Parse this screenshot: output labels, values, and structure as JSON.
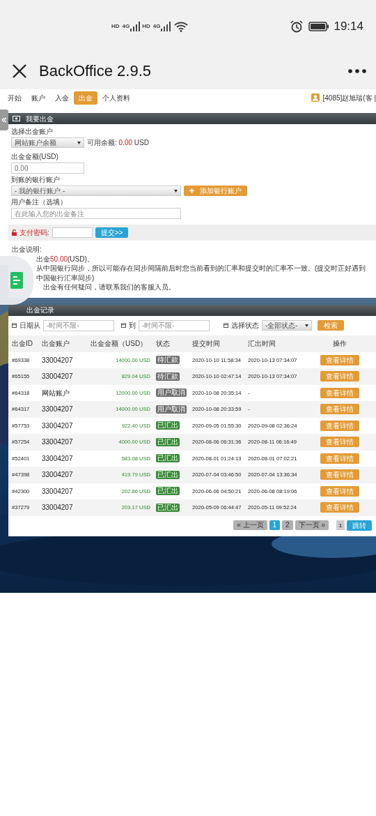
{
  "status_bar": {
    "sims": [
      {
        "hd": "HD",
        "net": "4G"
      },
      {
        "hd": "HD",
        "net": "4G"
      }
    ],
    "time": "19:14"
  },
  "app_bar": {
    "title": "BackOffice 2.9.5"
  },
  "nav": {
    "items": [
      {
        "label": "开始",
        "selected": false
      },
      {
        "label": "账户",
        "selected": false
      },
      {
        "label": "入金",
        "selected": false
      },
      {
        "label": "出金",
        "selected": true
      },
      {
        "label": "个人资料",
        "selected": false
      }
    ],
    "user": "[4085]赵旭瑞(客 |"
  },
  "withdraw_form": {
    "title": "我要出金",
    "account_label": "选择出金账户",
    "account_value": "网站账户余额",
    "balance_label": "可用余额:",
    "balance_value": "0.00",
    "balance_currency": "USD",
    "amount_label": "出金金额(USD)",
    "amount_value": "0.00",
    "bank_label": "到账的银行账户",
    "bank_value": "- 我的银行账户 -",
    "add_bank_button": "添加银行账户",
    "remark_label": "用户备注（选填）",
    "remark_placeholder": "在此输入您的出金备注",
    "password_label": "支付密码:",
    "submit_button": "提交>>"
  },
  "notes": {
    "title": "出金说明:",
    "min_line": {
      "before": "出金",
      "amount": "50.00",
      "after": "(USD)。"
    },
    "lines": [
      "从中国银行同步，所以可能存在同步间隔前后时您当前看到的汇率和提交时的汇率不一致。(提交时正好遇到中国银行汇率同步)",
      "出金有任何疑问，请联系我们的客服人员。"
    ]
  },
  "records": {
    "title": "出金记录",
    "filters": {
      "date_from_label": "日期从",
      "date_from_placeholder": "-时间不限-",
      "date_to_label": "到",
      "date_to_placeholder": "-时间不限-",
      "status_label": "选择状态",
      "status_value": "-全部状态-",
      "search_button": "检索"
    },
    "columns": [
      "出金ID",
      "出金账户",
      "出金金额（USD）",
      "状态",
      "提交时间",
      "汇出时间",
      "操作"
    ],
    "rows": [
      {
        "id": "#69338",
        "account": "33004207",
        "amount": "14000.00 USD",
        "status": "待汇款",
        "kind": "pending",
        "submitted": "2020-10-10 11:58:34",
        "paid": "2020-10-13 07:34:07",
        "action": "查看详情"
      },
      {
        "id": "#65155",
        "account": "33004207",
        "amount": "829.04 USD",
        "status": "待汇款",
        "kind": "pending",
        "submitted": "2020-10-10 02:47:14",
        "paid": "2020-10-13 07:34:07",
        "action": "查看详情"
      },
      {
        "id": "#64318",
        "account": "网站账户",
        "amount": "12000.00 USD",
        "status": "用户取消",
        "kind": "cancelled",
        "submitted": "2020-10-08 20:35:14",
        "paid": "-",
        "action": "查看详情"
      },
      {
        "id": "#64317",
        "account": "33004207",
        "amount": "14000.00 USD",
        "status": "用户取消",
        "kind": "cancelled",
        "submitted": "2020-10-08 20:33:59",
        "paid": "-",
        "action": "查看详情"
      },
      {
        "id": "#57753",
        "account": "33004207",
        "amount": "922.40 USD",
        "status": "已汇出",
        "kind": "paid",
        "submitted": "2020-09-05 01:55:30",
        "paid": "2020-09-08 02:36:24",
        "action": "查看详情"
      },
      {
        "id": "#57254",
        "account": "33004207",
        "amount": "4000.00 USD",
        "status": "已汇出",
        "kind": "paid",
        "submitted": "2020-08-06 06:31:36",
        "paid": "2020-08-11 06:16:49",
        "action": "查看详情"
      },
      {
        "id": "#52401",
        "account": "33004207",
        "amount": "583.08 USD",
        "status": "已汇出",
        "kind": "paid",
        "submitted": "2020-08-01 01:24:13",
        "paid": "2020-08-01 07:02:21",
        "action": "查看详情"
      },
      {
        "id": "#47398",
        "account": "33004207",
        "amount": "419.79 USD",
        "status": "已汇出",
        "kind": "paid",
        "submitted": "2020-07-04 03:46:50",
        "paid": "2020-07-04 13:36:34",
        "action": "查看详情"
      },
      {
        "id": "#42300",
        "account": "33004207",
        "amount": "202.86 USD",
        "status": "已汇出",
        "kind": "paid",
        "submitted": "2020-06-06 04:50:21",
        "paid": "2020-06-08 08:19:06",
        "action": "查看详情"
      },
      {
        "id": "#37279",
        "account": "33004207",
        "amount": "203.17 USD",
        "status": "已汇出",
        "kind": "paid",
        "submitted": "2020-05-09 06:44:47",
        "paid": "2020-05-11 09:52:24",
        "action": "查看详情"
      }
    ],
    "pagination": {
      "prev": "« 上一页",
      "pages": [
        {
          "label": "1",
          "selected": true
        },
        {
          "label": "2",
          "selected": false
        }
      ],
      "next": "下一页 »",
      "jump_value": "1",
      "jump_button": "跳转"
    }
  }
}
